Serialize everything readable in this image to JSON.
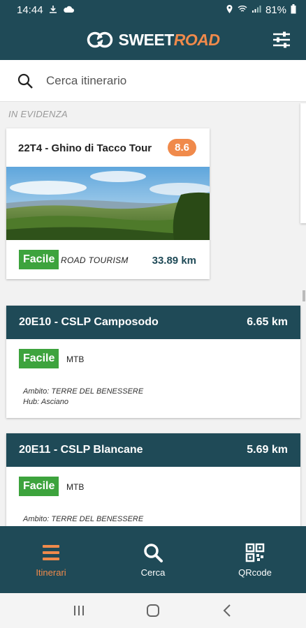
{
  "status": {
    "time": "14:44",
    "battery": "81%"
  },
  "header": {
    "logo_main": "SWEET",
    "logo_accent": "ROAD"
  },
  "search": {
    "placeholder": "Cerca itinerario"
  },
  "featured": {
    "section_label": "IN EVIDENZA",
    "title": "22T4 - Ghino di Tacco Tour",
    "rating": "8.6",
    "difficulty": "Facile",
    "type": "ROAD  TOURISM",
    "distance": "33.89 km"
  },
  "routes": [
    {
      "title": "20E10 - CSLP Camposodo",
      "distance": "6.65 km",
      "difficulty": "Facile",
      "type": "MTB",
      "ambito": "Ambito: TERRE DEL BENESSERE",
      "hub": "Hub: Asciano"
    },
    {
      "title": "20E11 - CSLP Blancane",
      "distance": "5.69 km",
      "difficulty": "Facile",
      "type": "MTB",
      "ambito": "Ambito: TERRE DEL BENESSERE"
    }
  ],
  "nav": {
    "items": [
      {
        "label": "Itinerari",
        "icon": "list-icon",
        "active": true
      },
      {
        "label": "Cerca",
        "icon": "search-icon",
        "active": false
      },
      {
        "label": "QRcode",
        "icon": "qrcode-icon",
        "active": false
      }
    ]
  },
  "colors": {
    "primary": "#1f4a57",
    "accent": "#f08a4b",
    "easy": "#3da33d"
  }
}
